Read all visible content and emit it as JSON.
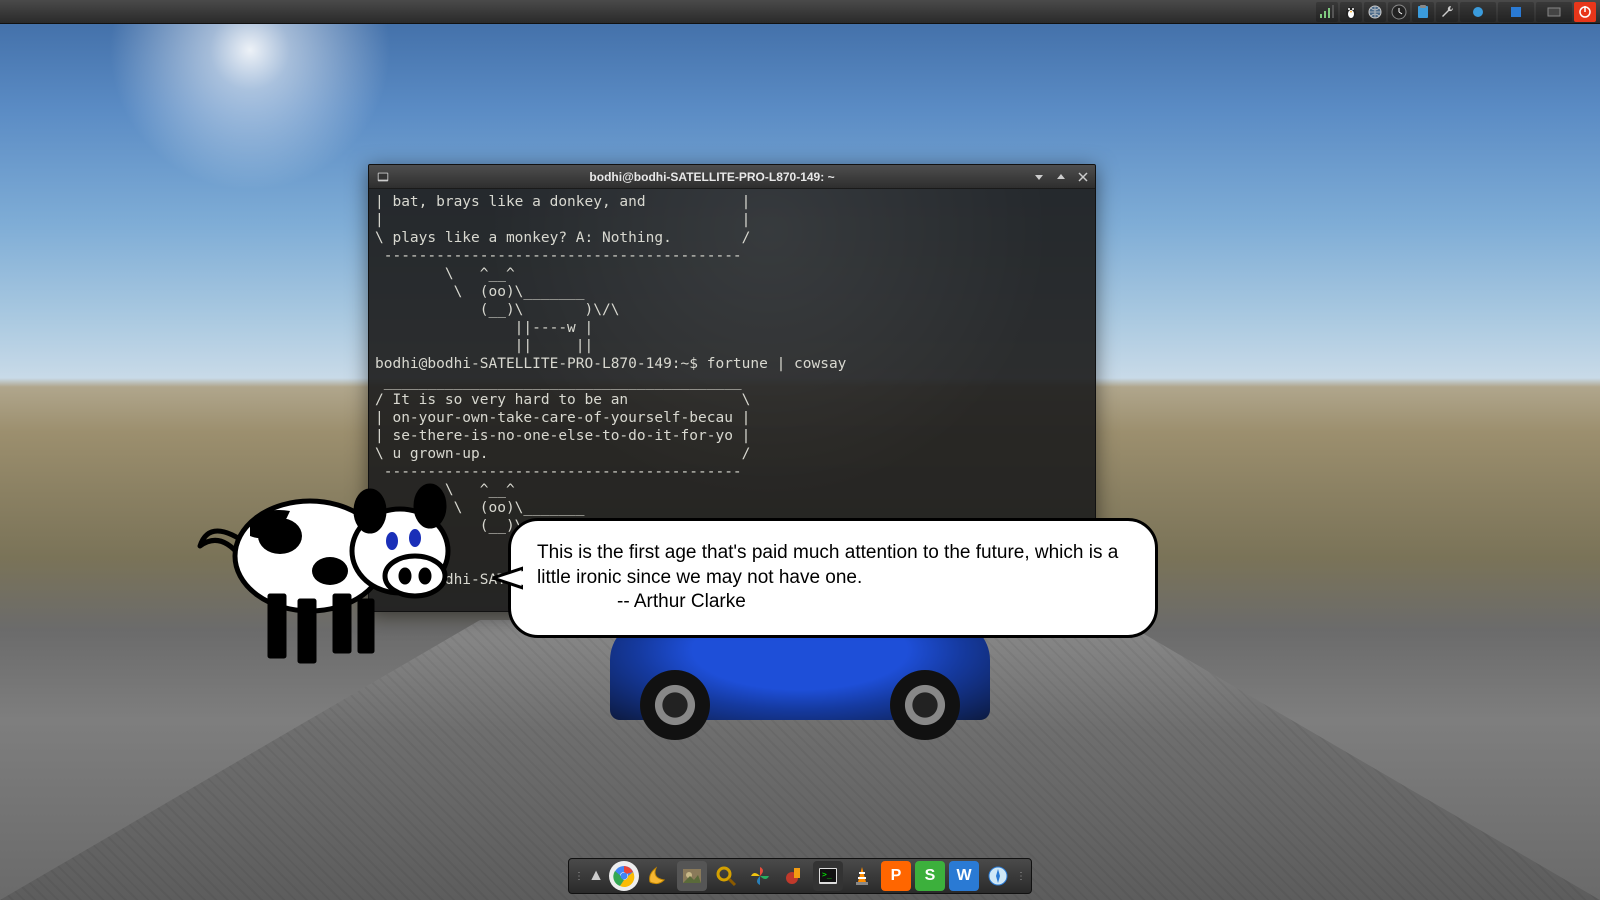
{
  "terminal": {
    "title": "bodhi@bodhi-SATELLITE-PRO-L870-149: ~",
    "content": "| bat, brays like a donkey, and           |\n|                                         |\n\\ plays like a monkey? A: Nothing.        /\n -----------------------------------------\n        \\   ^__^\n         \\  (oo)\\_______\n            (__)\\       )\\/\\\n                ||----w |\n                ||     ||\nbodhi@bodhi-SATELLITE-PRO-L870-149:~$ fortune | cowsay\n _________________________________________\n/ It is so very hard to be an             \\\n| on-your-own-take-care-of-yourself-becau |\n| se-there-is-no-one-else-to-do-it-for-yo |\n\\ u grown-up.                             /\n -----------------------------------------\n        \\   ^__^\n         \\  (oo)\\_______\n            (__)\\       )\\/\\\n                ||----w |\n                ||     ||\nbodhi@bodhi-SATELLITE-PRO-L870-149:~$ "
  },
  "speech": {
    "line1": "This is the first age that's paid much attention to the future, which is a little ironic since we may not have one.",
    "attribution": "-- Arthur Clarke"
  },
  "top_tray": {
    "signal": "signal-icon",
    "tux": "penguin-icon",
    "globe": "globe-icon",
    "clock": "clock-icon",
    "clipboard": "clipboard-icon",
    "settings": "wrench-icon",
    "task1": "task-item",
    "task2": "task-item",
    "task3": "task-item",
    "power": "power-icon"
  },
  "dock": {
    "arrow": "▲",
    "dots": "⋮"
  },
  "colors": {
    "panel_bg": "#2e2e2e",
    "terminal_bg": "#1e1e1e",
    "terminal_fg": "#d8d8d0",
    "accent_orange": "#ff6600",
    "accent_green": "#3cb03c",
    "accent_blue": "#2a7ad4"
  }
}
